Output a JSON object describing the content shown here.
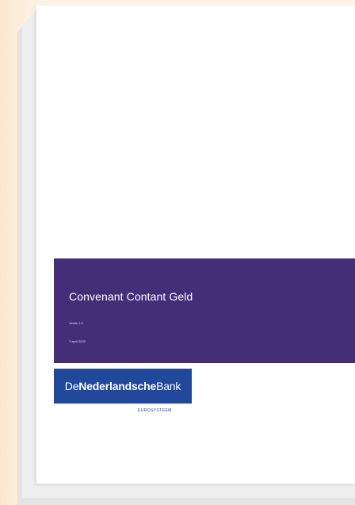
{
  "cover": {
    "title": "Convenant Contant Geld",
    "version": "Versie 1.0",
    "date": "7 april 2022"
  },
  "logo": {
    "part_de": "De",
    "part_nederlandsche": "Nederlandsche",
    "part_bank": "Bank",
    "subtitle": "EUROSYSTEEM"
  },
  "colors": {
    "band": "#442e78",
    "logo": "#21489b",
    "background": "#fdf1e3"
  }
}
